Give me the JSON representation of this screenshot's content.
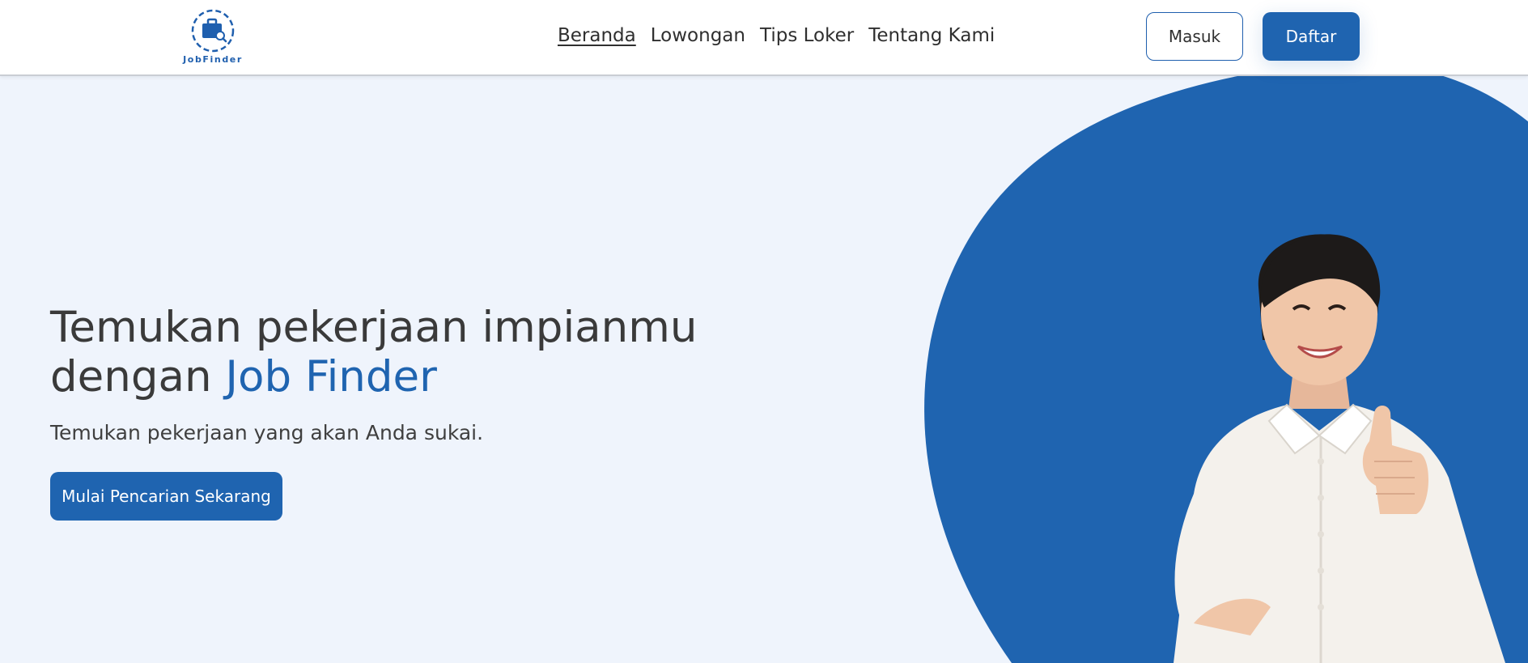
{
  "brand": {
    "logo_text": "JobFinder",
    "accent_color": "#1f64b0"
  },
  "nav": {
    "items": [
      {
        "label": "Beranda",
        "active": true
      },
      {
        "label": "Lowongan",
        "active": false
      },
      {
        "label": "Tips Loker",
        "active": false
      },
      {
        "label": "Tentang Kami",
        "active": false
      }
    ]
  },
  "auth": {
    "login_label": "Masuk",
    "register_label": "Daftar"
  },
  "hero": {
    "title_line1": "Temukan pekerjaan impianmu",
    "title_line2_prefix": "dengan ",
    "title_line2_accent": "Job Finder",
    "subtitle": "Temukan pekerjaan yang akan Anda sukai.",
    "cta_label": "Mulai Pencarian Sekarang"
  },
  "icons": {
    "logo": "briefcase-search-icon"
  }
}
